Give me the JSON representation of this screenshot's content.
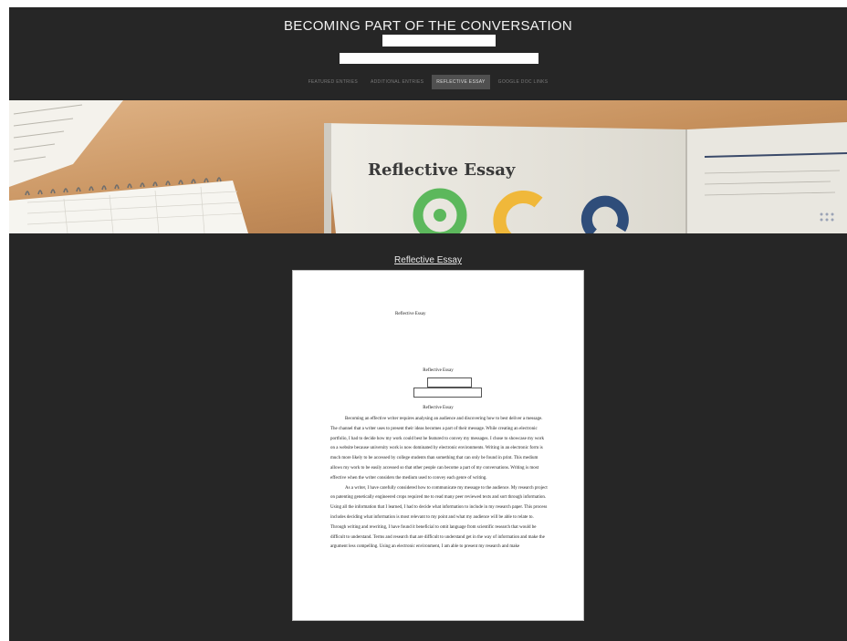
{
  "site": {
    "title": "BECOMING PART OF THE CONVERSATION"
  },
  "nav": {
    "items": [
      {
        "label": "FEATURED ENTRIES",
        "active": false
      },
      {
        "label": "ADDITIONAL ENTRIES",
        "active": false
      },
      {
        "label": "REFLECTIVE ESSAY",
        "active": true
      },
      {
        "label": "GOOGLE DOC LINKS",
        "active": false
      }
    ]
  },
  "hero": {
    "title": "Reflective Essay"
  },
  "main": {
    "link": "Reflective Essay"
  },
  "document": {
    "cover_title": "Reflective Essay",
    "header_title": "Reflective Essay",
    "body_title": "Reflective Essay",
    "paragraphs": [
      "Becoming an effective writer requires analysing an audience and discovering how to best deliver a message. The channel that a writer uses to present their ideas becomes a part of their message. While creating an electronic portfolio, I had to decide how my work could best be featured to convey my messages. I chose to showcase my work on a website because university work is now dominated by electronic environments. Writing in an electronic form is much more likely to be accessed by college students than something that can only be found in print. This medium allows my work to be easily accessed so that other people can become a part of my conversations. Writing is most effective when the writer considers the medium used to convey each genre of writing.",
      "As a writer, I have carefully considered how to communicate my message to the audience. My research project on patenting genetically engineered crops required me to read many peer reviewed texts and sort through information. Using all the information that I learned, I had to decide what information to include in my research paper. This process includes deciding what information is most relevant to my point and what my audience will be able to relate to. Through writing and rewriting, I have found it beneficial to omit language from scientific research that would be difficult to understand. Terms and research that are difficult to understand get in the way of information and make the argument less compelling. Using an electronic environment, I am able to present my research and make"
    ]
  },
  "colors": {
    "background": "#262626",
    "nav_active": "#505050"
  }
}
